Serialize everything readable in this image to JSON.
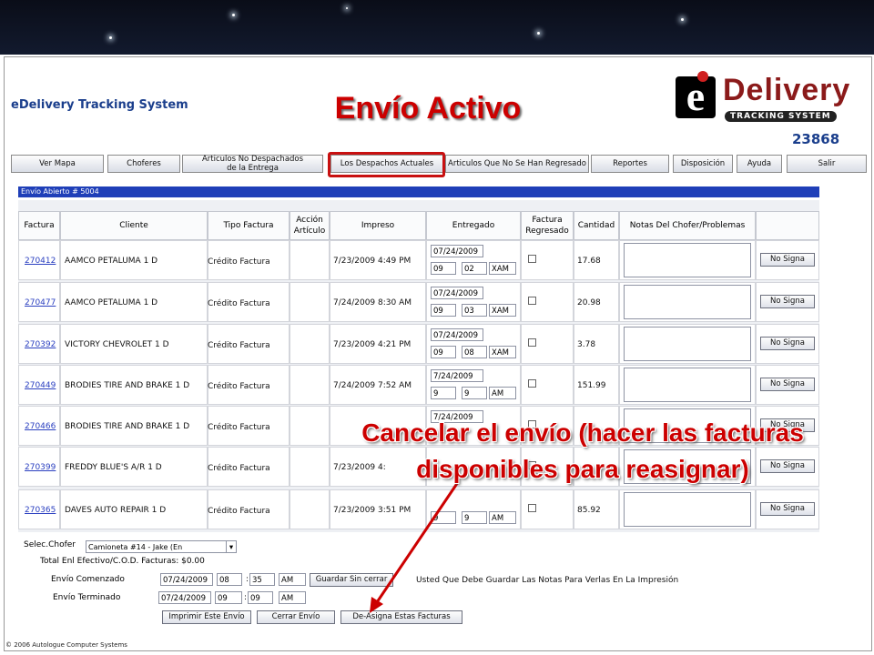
{
  "header": {
    "brand": "eDelivery Tracking System",
    "slide_title": "Envío Activo",
    "logo_letter": "e",
    "logo_word": "Delivery",
    "logo_sub": "TRACKING SYSTEM",
    "id_number": "23868"
  },
  "nav": [
    {
      "label": "Ver Mapa"
    },
    {
      "label": "Choferes"
    },
    {
      "label": "Articulos No Despachados de la Entrega"
    },
    {
      "label": "Los Despachos Actuales"
    },
    {
      "label": "Articulos Que No Se Han Regresado"
    },
    {
      "label": "Reportes"
    },
    {
      "label": "Disposición"
    },
    {
      "label": "Ayuda"
    },
    {
      "label": "Salir"
    }
  ],
  "dispatch_bar": "Envío Abierto # 5004",
  "columns": {
    "factura": "Factura",
    "cliente": "Cliente",
    "tipo": "Tipo Factura",
    "accion": "Acción Artículo",
    "impreso": "Impreso",
    "entregado": "Entregado",
    "regresado": "Factura Regresado",
    "cantidad": "Cantidad",
    "notas": "Notas Del Chofer/Problemas"
  },
  "rows": [
    {
      "factura": "270412",
      "cliente": "AAMCO PETALUMA 1 D",
      "tipo": "Crédito Factura",
      "impreso": "7/23/2009 4:49 PM",
      "fecha": "07/24/2009",
      "hora": "09",
      "min": "02",
      "ampm": "XAM",
      "cantidad": "17.68",
      "accion_btn": "No Signa"
    },
    {
      "factura": "270477",
      "cliente": "AAMCO PETALUMA 1 D",
      "tipo": "Crédito Factura",
      "impreso": "7/24/2009 8:30 AM",
      "fecha": "07/24/2009",
      "hora": "09",
      "min": "03",
      "ampm": "XAM",
      "cantidad": "20.98",
      "accion_btn": "No Signa"
    },
    {
      "factura": "270392",
      "cliente": "VICTORY CHEVROLET 1 D",
      "tipo": "Crédito Factura",
      "impreso": "7/23/2009 4:21 PM",
      "fecha": "07/24/2009",
      "hora": "09",
      "min": "08",
      "ampm": "XAM",
      "cantidad": "3.78",
      "accion_btn": "No Signa"
    },
    {
      "factura": "270449",
      "cliente": "BRODIES TIRE AND BRAKE 1 D",
      "tipo": "Crédito Factura",
      "impreso": "7/24/2009 7:52 AM",
      "fecha": "7/24/2009",
      "hora": "9",
      "min": "9",
      "ampm": "AM",
      "cantidad": "151.99",
      "accion_btn": "No Signa"
    },
    {
      "factura": "270466",
      "cliente": "BRODIES TIRE AND BRAKE 1 D",
      "tipo": "Crédito Factura",
      "impreso": "",
      "fecha": "7/24/2009",
      "hora": "",
      "min": "",
      "ampm": "",
      "cantidad": "",
      "accion_btn": "No Signa"
    },
    {
      "factura": "270399",
      "cliente": "FREDDY BLUE'S A/R 1 D",
      "tipo": "Crédito Factura",
      "impreso": "7/23/2009 4:",
      "fecha": "",
      "hora": "",
      "min": "",
      "ampm": "",
      "cantidad": "",
      "accion_btn": "No Signa"
    },
    {
      "factura": "270365",
      "cliente": "DAVES AUTO REPAIR 1 D",
      "tipo": "Crédito Factura",
      "impreso": "7/23/2009 3:51 PM",
      "fecha": "",
      "hora": "9",
      "min": "9",
      "ampm": "AM",
      "cantidad": "85.92",
      "accion_btn": "No Signa"
    }
  ],
  "footer": {
    "chofer_label": "Selec.Chofer",
    "chofer_value": "Camioneta #14 - Jake (En",
    "total_label": "Total Enl Efectivo/C.O.D. Facturas: $0.00",
    "comenzado_label": "Envío Comenzado",
    "comenzado_fecha": "07/24/2009",
    "comenzado_hora": "08",
    "comenzado_min": "35",
    "comenzado_ampm": "AM",
    "guardar_btn": "Guardar Sin cerrar",
    "nota": "Usted Que Debe Guardar Las Notas Para Verlas En La Impresión",
    "terminado_label": "Envío Terminado",
    "terminado_fecha": "07/24/2009",
    "terminado_hora": "09",
    "terminado_min": "09",
    "terminado_ampm": "AM",
    "imprimir_btn": "Imprimir Este Envío",
    "cerrar_btn": "Cerrar Envío",
    "desasigna_btn": "De-Asigna Estas Facturas"
  },
  "copyright": "© 2006 Autologue Computer Systems",
  "annotation": "Cancelar el envío (hacer las facturas disponibles para reasignar)",
  "colors": {
    "accent_red": "#cc0000",
    "nav_blue": "#1f3fb8",
    "link_blue": "#2a3fc0"
  }
}
